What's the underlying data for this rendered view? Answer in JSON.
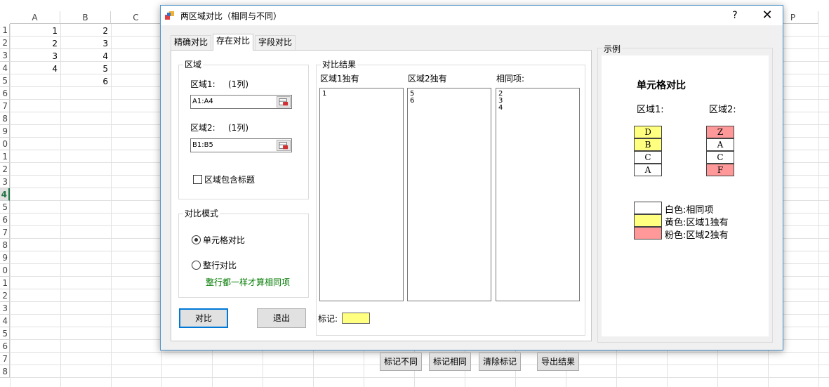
{
  "sheet": {
    "cols": [
      "A",
      "B",
      "C",
      "P"
    ],
    "rows": [
      "1",
      "2",
      "3",
      "4",
      "5",
      "6",
      "7",
      "8",
      "9",
      "0",
      "1",
      "2",
      "3",
      "4",
      "5",
      "6",
      "7",
      "8",
      "9",
      "0",
      "1",
      "2",
      "3",
      "4",
      "5",
      "6",
      "7",
      "8"
    ],
    "colA": [
      "1",
      "2",
      "3",
      "4"
    ],
    "colB": [
      "2",
      "3",
      "4",
      "5",
      "6"
    ]
  },
  "dialog": {
    "title": "两区域对比（相同与不同）",
    "help": "?",
    "close": "✕",
    "tabs": [
      "精确对比",
      "存在对比",
      "字段对比"
    ],
    "region": {
      "title": "区域",
      "r1_label": "区域1:",
      "r1_cols": "(1列)",
      "r1_value": "A1:A4",
      "r2_label": "区域2:",
      "r2_cols": "(1列)",
      "r2_value": "B1:B5",
      "header_checkbox": "区域包含标题"
    },
    "mode": {
      "title": "对比模式",
      "opt_cell": "单元格对比",
      "opt_row": "整行对比",
      "row_note": "整行都一样才算相同项",
      "note_color": "#007a00"
    },
    "buttons": {
      "compare": "对比",
      "exit": "退出"
    },
    "result": {
      "title": "对比结果",
      "col1_header": "区域1独有",
      "col2_header": "区域2独有",
      "col3_header": "相同项:",
      "col1_items": [
        "1"
      ],
      "col2_items": [
        "5",
        "6"
      ],
      "col3_items": [
        "2",
        "3",
        "4"
      ],
      "mark_label": "标记:",
      "mark_color": "#ffff80",
      "btn_mark_diff": "标记不同",
      "btn_mark_same": "标记相同",
      "btn_clear": "清除标记",
      "btn_export": "导出结果"
    },
    "example": {
      "title": "示例",
      "heading": "单元格对比",
      "r1_label": "区域1:",
      "r2_label": "区域2:",
      "r1_cells": [
        {
          "v": "D",
          "c": "#ffff80"
        },
        {
          "v": "B",
          "c": "#ffff80"
        },
        {
          "v": "C",
          "c": "#ffffff"
        },
        {
          "v": "A",
          "c": "#ffffff"
        }
      ],
      "r2_cells": [
        {
          "v": "Z",
          "c": "#ff9999"
        },
        {
          "v": "A",
          "c": "#ffffff"
        },
        {
          "v": "C",
          "c": "#ffffff"
        },
        {
          "v": "F",
          "c": "#ff9999"
        }
      ],
      "legend": [
        {
          "c": "#ffffff",
          "t": "白色:相同项"
        },
        {
          "c": "#ffff80",
          "t": "黄色:区域1独有"
        },
        {
          "c": "#ff9999",
          "t": "粉色:区域2独有"
        }
      ]
    }
  }
}
